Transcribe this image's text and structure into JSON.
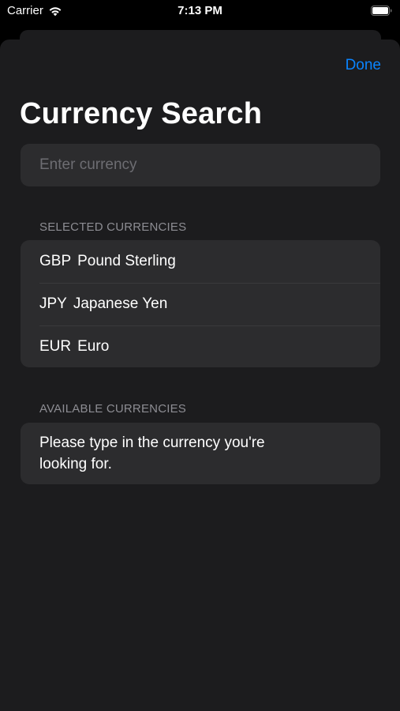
{
  "status_bar": {
    "carrier": "Carrier",
    "time": "7:13 PM",
    "icons": [
      "wifi-icon",
      "battery-icon"
    ]
  },
  "sheet": {
    "done_label": "Done",
    "title": "Currency Search",
    "search": {
      "placeholder": "Enter currency",
      "value": ""
    },
    "selected_header": "SELECTED CURRENCIES",
    "selected_currencies": [
      {
        "code": "GBP",
        "name": "Pound Sterling"
      },
      {
        "code": "JPY",
        "name": "Japanese Yen"
      },
      {
        "code": "EUR",
        "name": "Euro"
      }
    ],
    "available_header": "AVAILABLE CURRENCIES",
    "available_message": "Please type in the currency you're looking for."
  },
  "colors": {
    "background": "#000000",
    "sheet": "#1c1c1e",
    "grouped_cell": "#2c2c2e",
    "accent": "#0a84ff",
    "secondary_text": "#8d8d93"
  }
}
